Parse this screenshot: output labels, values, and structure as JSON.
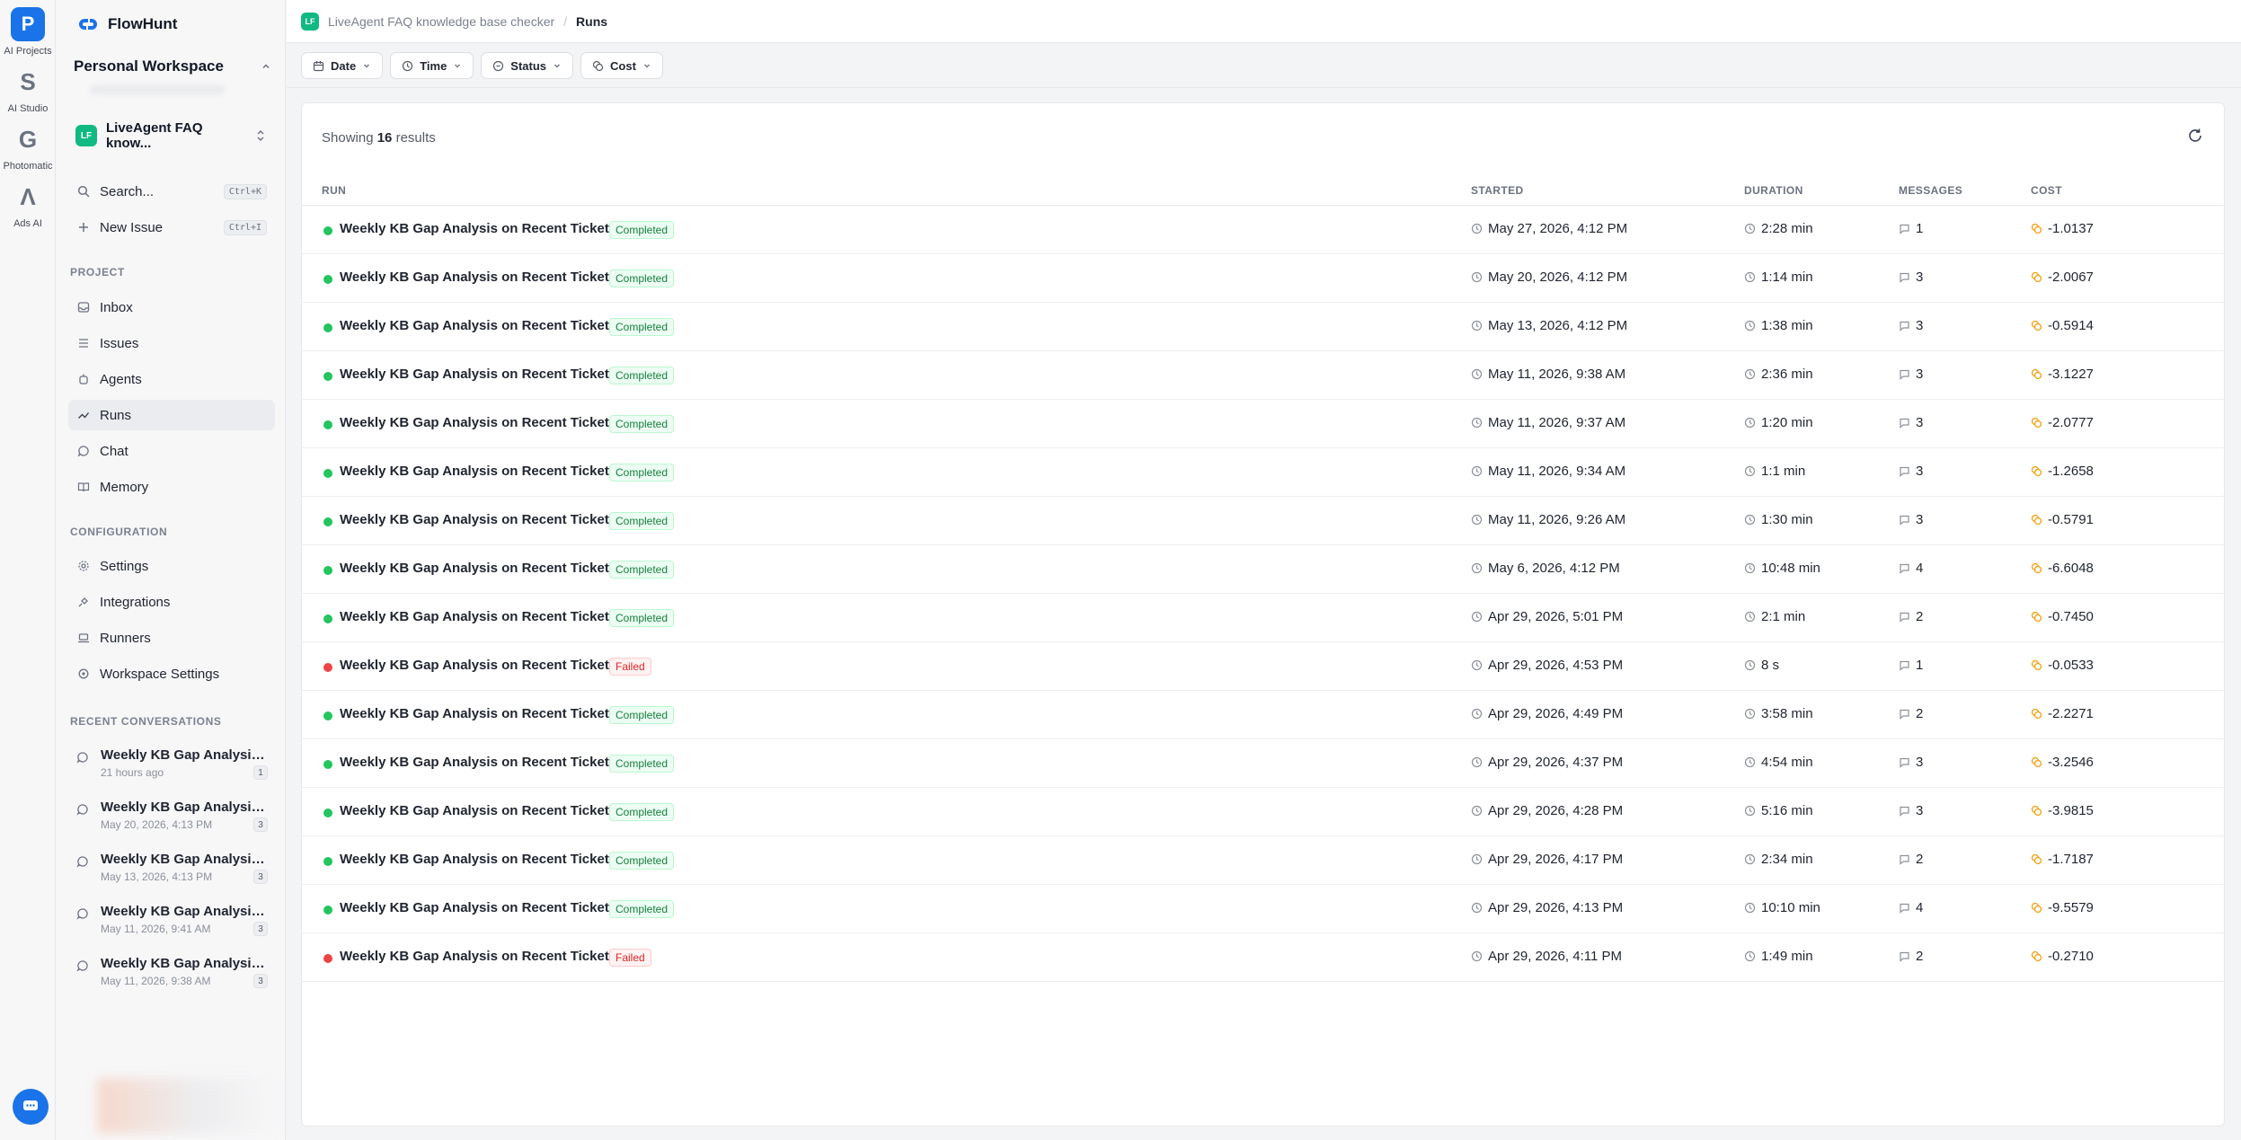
{
  "rail": [
    {
      "name": "ai-projects",
      "label": "AI Projects",
      "icon": "projects-icon",
      "glyph": "P"
    },
    {
      "name": "ai-studio",
      "label": "AI Studio",
      "icon": "studio-icon",
      "glyph": "S"
    },
    {
      "name": "photomatic",
      "label": "Photomatic",
      "icon": "photomatic-icon",
      "glyph": "G"
    },
    {
      "name": "ads-ai",
      "label": "Ads AI",
      "icon": "ads-icon",
      "glyph": "Λ"
    }
  ],
  "brand": {
    "name": "FlowHunt"
  },
  "workspace": {
    "name": "Personal Workspace"
  },
  "project": {
    "badge": "LF",
    "name": "LiveAgent FAQ know..."
  },
  "quick": {
    "search": {
      "label": "Search...",
      "shortcut": "Ctrl+K"
    },
    "new_issue": {
      "label": "New Issue",
      "shortcut": "Ctrl+I"
    }
  },
  "sections": {
    "project": "PROJECT",
    "configuration": "CONFIGURATION",
    "recent": "RECENT CONVERSATIONS"
  },
  "nav_project": [
    {
      "name": "inbox",
      "label": "Inbox",
      "icon": "inbox-icon"
    },
    {
      "name": "issues",
      "label": "Issues",
      "icon": "list-icon"
    },
    {
      "name": "agents",
      "label": "Agents",
      "icon": "agent-icon"
    },
    {
      "name": "runs",
      "label": "Runs",
      "icon": "trend-icon",
      "active": true
    },
    {
      "name": "chat",
      "label": "Chat",
      "icon": "chat-icon"
    },
    {
      "name": "memory",
      "label": "Memory",
      "icon": "book-icon"
    }
  ],
  "nav_config": [
    {
      "name": "settings",
      "label": "Settings",
      "icon": "gear-icon"
    },
    {
      "name": "integrations",
      "label": "Integrations",
      "icon": "plug-icon"
    },
    {
      "name": "runners",
      "label": "Runners",
      "icon": "laptop-icon"
    },
    {
      "name": "workspace-settings",
      "label": "Workspace Settings",
      "icon": "workspace-gear-icon"
    }
  ],
  "recent": [
    {
      "title": "Weekly KB Gap Analysis on Recent Tickets",
      "sub": "21 hours ago",
      "count": "1"
    },
    {
      "title": "Weekly KB Gap Analysis on Recent Tickets",
      "sub": "May 20, 2026, 4:13 PM",
      "count": "3"
    },
    {
      "title": "Weekly KB Gap Analysis on Recent Tickets",
      "sub": "May 13, 2026, 4:13 PM",
      "count": "3"
    },
    {
      "title": "Weekly KB Gap Analysis on Recent Tickets",
      "sub": "May 11, 2026, 9:41 AM",
      "count": "3"
    },
    {
      "title": "Weekly KB Gap Analysis on Recent Tickets",
      "sub": "May 11, 2026, 9:38 AM",
      "count": "3"
    }
  ],
  "breadcrumb": {
    "badge": "LF",
    "project": "LiveAgent FAQ knowledge base checker",
    "sep": "/",
    "current": "Runs"
  },
  "filters": [
    {
      "name": "date",
      "label": "Date",
      "icon": "calendar-icon"
    },
    {
      "name": "time",
      "label": "Time",
      "icon": "clock-icon"
    },
    {
      "name": "status",
      "label": "Status",
      "icon": "status-icon"
    },
    {
      "name": "cost",
      "label": "Cost",
      "icon": "coins-icon"
    }
  ],
  "results": {
    "prefix": "Showing",
    "count": "16",
    "suffix": "results"
  },
  "columns": {
    "run": "RUN",
    "started": "STARTED",
    "duration": "DURATION",
    "messages": "MESSAGES",
    "cost": "COST"
  },
  "colors": {
    "success": "#22c55e",
    "failed": "#ef4444",
    "accent": "#1a73e8",
    "project_badge": "#10b981"
  },
  "runs": [
    {
      "name": "Weekly KB Gap Analysis on Recent Tickets",
      "status": "Completed",
      "started": "May 27, 2026, 4:12 PM",
      "duration": "2:28 min",
      "messages": "1",
      "cost": "-1.0137"
    },
    {
      "name": "Weekly KB Gap Analysis on Recent Tickets",
      "status": "Completed",
      "started": "May 20, 2026, 4:12 PM",
      "duration": "1:14 min",
      "messages": "3",
      "cost": "-2.0067"
    },
    {
      "name": "Weekly KB Gap Analysis on Recent Tickets",
      "status": "Completed",
      "started": "May 13, 2026, 4:12 PM",
      "duration": "1:38 min",
      "messages": "3",
      "cost": "-0.5914"
    },
    {
      "name": "Weekly KB Gap Analysis on Recent Tickets",
      "status": "Completed",
      "started": "May 11, 2026, 9:38 AM",
      "duration": "2:36 min",
      "messages": "3",
      "cost": "-3.1227"
    },
    {
      "name": "Weekly KB Gap Analysis on Recent Tickets",
      "status": "Completed",
      "started": "May 11, 2026, 9:37 AM",
      "duration": "1:20 min",
      "messages": "3",
      "cost": "-2.0777"
    },
    {
      "name": "Weekly KB Gap Analysis on Recent Tickets",
      "status": "Completed",
      "started": "May 11, 2026, 9:34 AM",
      "duration": "1:1 min",
      "messages": "3",
      "cost": "-1.2658"
    },
    {
      "name": "Weekly KB Gap Analysis on Recent Tickets",
      "status": "Completed",
      "started": "May 11, 2026, 9:26 AM",
      "duration": "1:30 min",
      "messages": "3",
      "cost": "-0.5791"
    },
    {
      "name": "Weekly KB Gap Analysis on Recent Tickets",
      "status": "Completed",
      "started": "May 6, 2026, 4:12 PM",
      "duration": "10:48 min",
      "messages": "4",
      "cost": "-6.6048"
    },
    {
      "name": "Weekly KB Gap Analysis on Recent Tickets",
      "status": "Completed",
      "started": "Apr 29, 2026, 5:01 PM",
      "duration": "2:1 min",
      "messages": "2",
      "cost": "-0.7450"
    },
    {
      "name": "Weekly KB Gap Analysis on Recent Tickets",
      "status": "Failed",
      "started": "Apr 29, 2026, 4:53 PM",
      "duration": "8 s",
      "messages": "1",
      "cost": "-0.0533"
    },
    {
      "name": "Weekly KB Gap Analysis on Recent Tickets",
      "status": "Completed",
      "started": "Apr 29, 2026, 4:49 PM",
      "duration": "3:58 min",
      "messages": "2",
      "cost": "-2.2271"
    },
    {
      "name": "Weekly KB Gap Analysis on Recent Tickets",
      "status": "Completed",
      "started": "Apr 29, 2026, 4:37 PM",
      "duration": "4:54 min",
      "messages": "3",
      "cost": "-3.2546"
    },
    {
      "name": "Weekly KB Gap Analysis on Recent Tickets",
      "status": "Completed",
      "started": "Apr 29, 2026, 4:28 PM",
      "duration": "5:16 min",
      "messages": "3",
      "cost": "-3.9815"
    },
    {
      "name": "Weekly KB Gap Analysis on Recent Tickets",
      "status": "Completed",
      "started": "Apr 29, 2026, 4:17 PM",
      "duration": "2:34 min",
      "messages": "2",
      "cost": "-1.7187"
    },
    {
      "name": "Weekly KB Gap Analysis on Recent Tickets",
      "status": "Completed",
      "started": "Apr 29, 2026, 4:13 PM",
      "duration": "10:10 min",
      "messages": "4",
      "cost": "-9.5579"
    },
    {
      "name": "Weekly KB Gap Analysis on Recent Tickets",
      "status": "Failed",
      "started": "Apr 29, 2026, 4:11 PM",
      "duration": "1:49 min",
      "messages": "2",
      "cost": "-0.2710"
    }
  ]
}
